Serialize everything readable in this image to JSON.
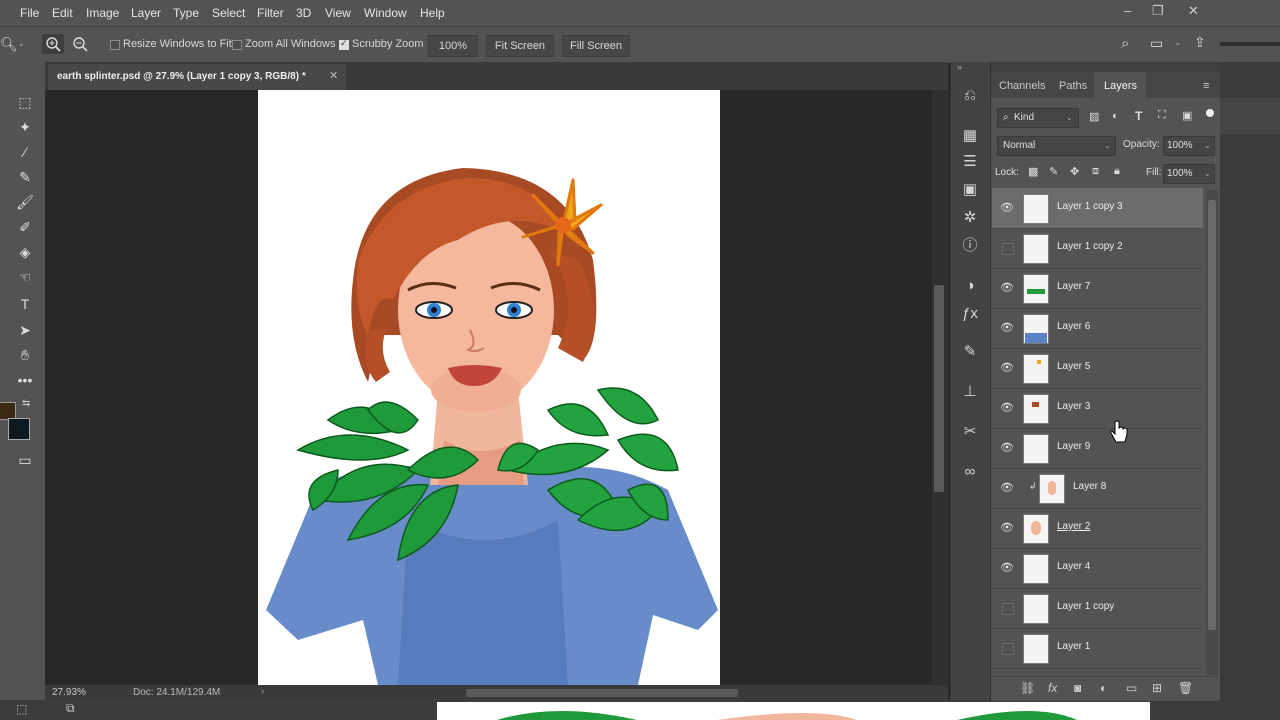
{
  "menu": [
    "File",
    "Edit",
    "Image",
    "Layer",
    "Type",
    "Select",
    "Filter",
    "3D",
    "View",
    "Window",
    "Help"
  ],
  "options": {
    "resize_windows": {
      "label": "Resize Windows to Fit",
      "checked": false
    },
    "zoom_all": {
      "label": "Zoom All Windows",
      "checked": false
    },
    "scrubby": {
      "label": "Scrubby Zoom",
      "checked": true
    },
    "zoom_value": "100%",
    "fit_screen": "Fit Screen",
    "fill_screen": "Fill Screen"
  },
  "document": {
    "tab_title": "earth splinter.psd @ 27.9% (Layer 1 copy 3, RGB/8) *",
    "zoom": "27.93%",
    "doc_size": "Doc: 24.1M/129.4M"
  },
  "panel": {
    "tabs": [
      "Channels",
      "Paths",
      "Layers"
    ],
    "active_tab": "Layers",
    "filter_kind": "Kind",
    "blend_mode": "Normal",
    "opacity_label": "Opacity:",
    "opacity": "100%",
    "lock_label": "Lock:",
    "fill_label": "Fill:",
    "fill": "100%"
  },
  "layers": [
    {
      "name": "Layer 1 copy 3",
      "visible": true,
      "selected": true
    },
    {
      "name": "Layer 1 copy 2",
      "visible": false,
      "selected": false
    },
    {
      "name": "Layer 7",
      "visible": true,
      "selected": false
    },
    {
      "name": "Layer 6",
      "visible": true,
      "selected": false
    },
    {
      "name": "Layer 5",
      "visible": true,
      "selected": false
    },
    {
      "name": "Layer 3",
      "visible": true,
      "selected": false
    },
    {
      "name": "Layer 9",
      "visible": true,
      "selected": false
    },
    {
      "name": "Layer 8",
      "visible": true,
      "selected": false,
      "clipped": true
    },
    {
      "name": "Layer 2",
      "visible": true,
      "selected": false
    },
    {
      "name": "Layer 4",
      "visible": true,
      "selected": false
    },
    {
      "name": "Layer 1 copy",
      "visible": false,
      "selected": false
    },
    {
      "name": "Layer 1",
      "visible": false,
      "selected": false
    }
  ],
  "colors": {
    "foreground": "#3a2a12",
    "background": "#0e1a22",
    "accent_skin": "#f2b79a",
    "accent_leaf": "#1f9a3a",
    "accent_dress": "#5c82c4"
  }
}
